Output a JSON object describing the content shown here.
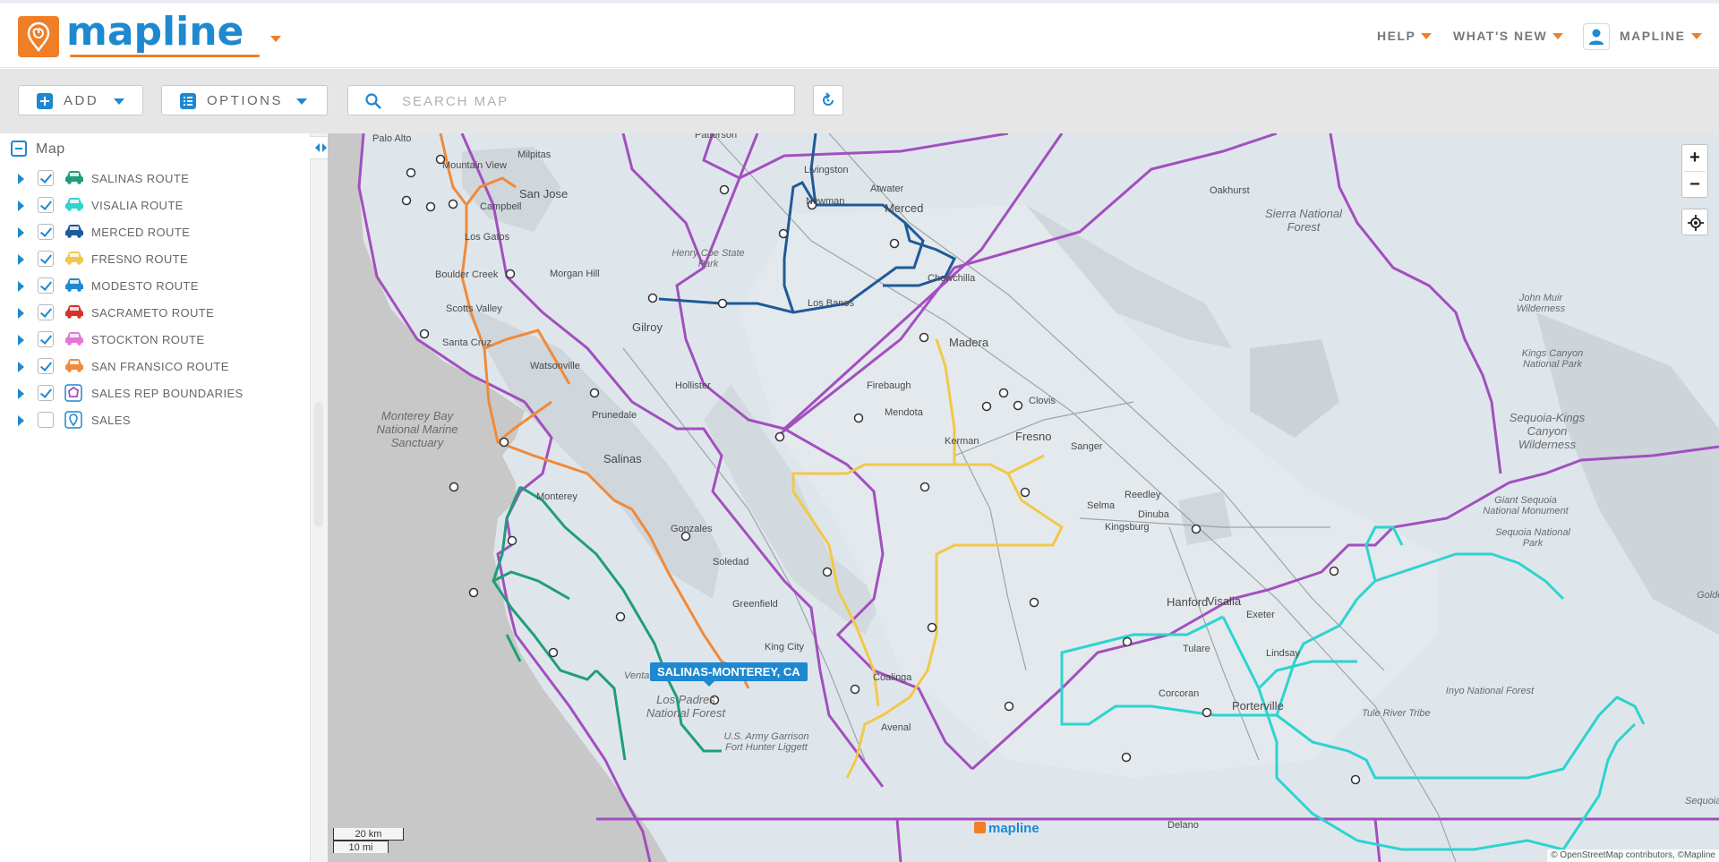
{
  "brand": {
    "logo_text": "mapline",
    "logo_icon": "map-pin-spiral-icon",
    "accent_color": "#f07e26",
    "primary_color": "#1e88d0"
  },
  "nav": {
    "help": "HELP",
    "whats_new": "WHAT'S NEW",
    "user": "MAPLINE"
  },
  "toolbar": {
    "add_label": "ADD",
    "options_label": "OPTIONS",
    "search_placeholder": "SEARCH MAP",
    "refresh_icon": "refresh-icon"
  },
  "panel": {
    "title": "Map",
    "layers": [
      {
        "label": "SALINAS ROUTE",
        "checked": true,
        "icon": "car-icon",
        "color": "#1f9e7a"
      },
      {
        "label": "VISALIA ROUTE",
        "checked": true,
        "icon": "car-icon",
        "color": "#2ed3cf"
      },
      {
        "label": "MERCED ROUTE",
        "checked": true,
        "icon": "car-icon",
        "color": "#1f5a99"
      },
      {
        "label": "FRESNO ROUTE",
        "checked": true,
        "icon": "car-icon",
        "color": "#f2c84b"
      },
      {
        "label": "MODESTO ROUTE",
        "checked": true,
        "icon": "car-icon",
        "color": "#1e88d0"
      },
      {
        "label": "SACRAMETO ROUTE",
        "checked": true,
        "icon": "car-icon",
        "color": "#d93025"
      },
      {
        "label": "STOCKTON ROUTE",
        "checked": true,
        "icon": "car-icon",
        "color": "#e377d6"
      },
      {
        "label": "SAN FRANSICO ROUTE",
        "checked": true,
        "icon": "car-icon",
        "color": "#f08a3a"
      },
      {
        "label": "SALES REP BOUNDARIES",
        "checked": true,
        "icon": "polygon-icon",
        "color": "#a24fbf"
      },
      {
        "label": "SALES",
        "checked": false,
        "icon": "map-pin-icon",
        "color": "#1e88d0"
      }
    ]
  },
  "map": {
    "popup": "SALINAS-MONTEREY, CA",
    "zoom_in": "+",
    "zoom_out": "−",
    "scale_km": "20 km",
    "scale_mi": "10 mi",
    "attribution": "© OpenStreetMap contributors, ©Mapline",
    "watermark": "mapline",
    "places": [
      {
        "name": "Palo Alto",
        "cls": ""
      },
      {
        "name": "Mountain View",
        "cls": ""
      },
      {
        "name": "Milpitas",
        "cls": ""
      },
      {
        "name": "San Jose",
        "cls": "big"
      },
      {
        "name": "Campbell",
        "cls": ""
      },
      {
        "name": "Los Gatos",
        "cls": ""
      },
      {
        "name": "Boulder Creek",
        "cls": ""
      },
      {
        "name": "Morgan Hill",
        "cls": ""
      },
      {
        "name": "Scotts Valley",
        "cls": ""
      },
      {
        "name": "Santa Cruz",
        "cls": ""
      },
      {
        "name": "Gilroy",
        "cls": "big"
      },
      {
        "name": "Henry Coe State Park",
        "cls": "it"
      },
      {
        "name": "Hollister",
        "cls": ""
      },
      {
        "name": "Watsonville",
        "cls": ""
      },
      {
        "name": "Prunedale",
        "cls": ""
      },
      {
        "name": "Salinas",
        "cls": "big"
      },
      {
        "name": "Monterey",
        "cls": ""
      },
      {
        "name": "Monterey Bay National Marine Sanctuary",
        "cls": "it big"
      },
      {
        "name": "Gonzales",
        "cls": ""
      },
      {
        "name": "Soledad",
        "cls": ""
      },
      {
        "name": "Greenfield",
        "cls": ""
      },
      {
        "name": "King City",
        "cls": ""
      },
      {
        "name": "Ventana Wilderness",
        "cls": "it"
      },
      {
        "name": "Los Padres National Forest",
        "cls": "it big"
      },
      {
        "name": "U.S. Army Garrison Fort Hunter Liggett",
        "cls": "it"
      },
      {
        "name": "Patterson",
        "cls": ""
      },
      {
        "name": "Livingston",
        "cls": ""
      },
      {
        "name": "Atwater",
        "cls": ""
      },
      {
        "name": "Merced",
        "cls": "big"
      },
      {
        "name": "Newman",
        "cls": ""
      },
      {
        "name": "Los Banos",
        "cls": ""
      },
      {
        "name": "Chowchilla",
        "cls": ""
      },
      {
        "name": "Madera",
        "cls": "big"
      },
      {
        "name": "Firebaugh",
        "cls": ""
      },
      {
        "name": "Mendota",
        "cls": ""
      },
      {
        "name": "Kerman",
        "cls": ""
      },
      {
        "name": "Fresno",
        "cls": "big"
      },
      {
        "name": "Clovis",
        "cls": ""
      },
      {
        "name": "Sanger",
        "cls": ""
      },
      {
        "name": "Reedley",
        "cls": ""
      },
      {
        "name": "Selma",
        "cls": ""
      },
      {
        "name": "Dinuba",
        "cls": ""
      },
      {
        "name": "Kingsburg",
        "cls": ""
      },
      {
        "name": "Hanford",
        "cls": "big"
      },
      {
        "name": "Visalia",
        "cls": "big"
      },
      {
        "name": "Exeter",
        "cls": ""
      },
      {
        "name": "Tulare",
        "cls": ""
      },
      {
        "name": "Lindsay",
        "cls": ""
      },
      {
        "name": "Corcoran",
        "cls": ""
      },
      {
        "name": "Porterville",
        "cls": "big"
      },
      {
        "name": "Coalinga",
        "cls": ""
      },
      {
        "name": "Avenal",
        "cls": ""
      },
      {
        "name": "Delano",
        "cls": ""
      },
      {
        "name": "Oakhurst",
        "cls": ""
      },
      {
        "name": "Sierra National Forest",
        "cls": "it big"
      },
      {
        "name": "John Muir Wilderness",
        "cls": "it"
      },
      {
        "name": "Kings Canyon National Park",
        "cls": "it"
      },
      {
        "name": "Sequoia-Kings Canyon Wilderness",
        "cls": "it big"
      },
      {
        "name": "Giant Sequoia National Monument",
        "cls": "it"
      },
      {
        "name": "Sequoia National Park",
        "cls": "it"
      },
      {
        "name": "Tule River Tribe",
        "cls": "it"
      },
      {
        "name": "Inyo National Forest",
        "cls": "it"
      },
      {
        "name": "Golden Trout Wilde",
        "cls": "it"
      },
      {
        "name": "Sequoia National",
        "cls": "it"
      }
    ]
  }
}
